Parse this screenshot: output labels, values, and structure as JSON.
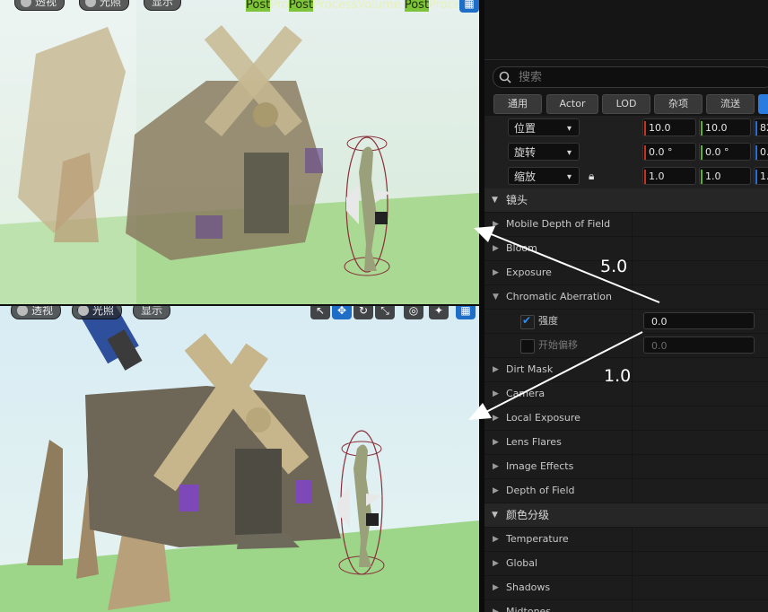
{
  "viewport_top": {
    "title_parts": [
      "Post",
      "Pro",
      "Post",
      "ProcessVolume",
      "Post",
      "ProcessV"
    ],
    "mode_perspective": "透视",
    "mode_lit": "光照",
    "mode_show": "显示"
  },
  "viewport_bottom": {
    "mode_perspective": "透视",
    "mode_lit": "光照",
    "mode_show": "显示"
  },
  "details": {
    "search_placeholder": "搜索",
    "tabs": [
      "通用",
      "Actor",
      "LOD",
      "杂项",
      "流送"
    ],
    "transform": [
      {
        "label": "位置",
        "x": "10.0",
        "y": "10.0",
        "z": "82"
      },
      {
        "label": "旋转",
        "x": "0.0 °",
        "y": "0.0 °",
        "z": "0."
      },
      {
        "label": "缩放",
        "x": "1.0",
        "y": "1.0",
        "z": "1."
      }
    ],
    "section_lens": "镜头",
    "lens_items": [
      "Mobile Depth of Field",
      "Bloom",
      "Exposure"
    ],
    "chromatic": {
      "label": "Chromatic Aberration",
      "intensity_label": "强度",
      "intensity_value": "0.0",
      "offset_label": "开始偏移",
      "offset_value": "0.0"
    },
    "lens_items_2": [
      "Dirt Mask",
      "Camera",
      "Local Exposure",
      "Lens Flares",
      "Image Effects",
      "Depth of Field"
    ],
    "section_color": "颜色分级",
    "color_items": [
      "Temperature",
      "Global",
      "Shadows",
      "Midtones"
    ]
  },
  "annotations": {
    "top_value": "5.0",
    "bottom_value": "1.0"
  },
  "colors": {
    "accent": "#2a7ce0",
    "sky_top": "#d9ecf5",
    "grass": "#8fcf7e"
  }
}
